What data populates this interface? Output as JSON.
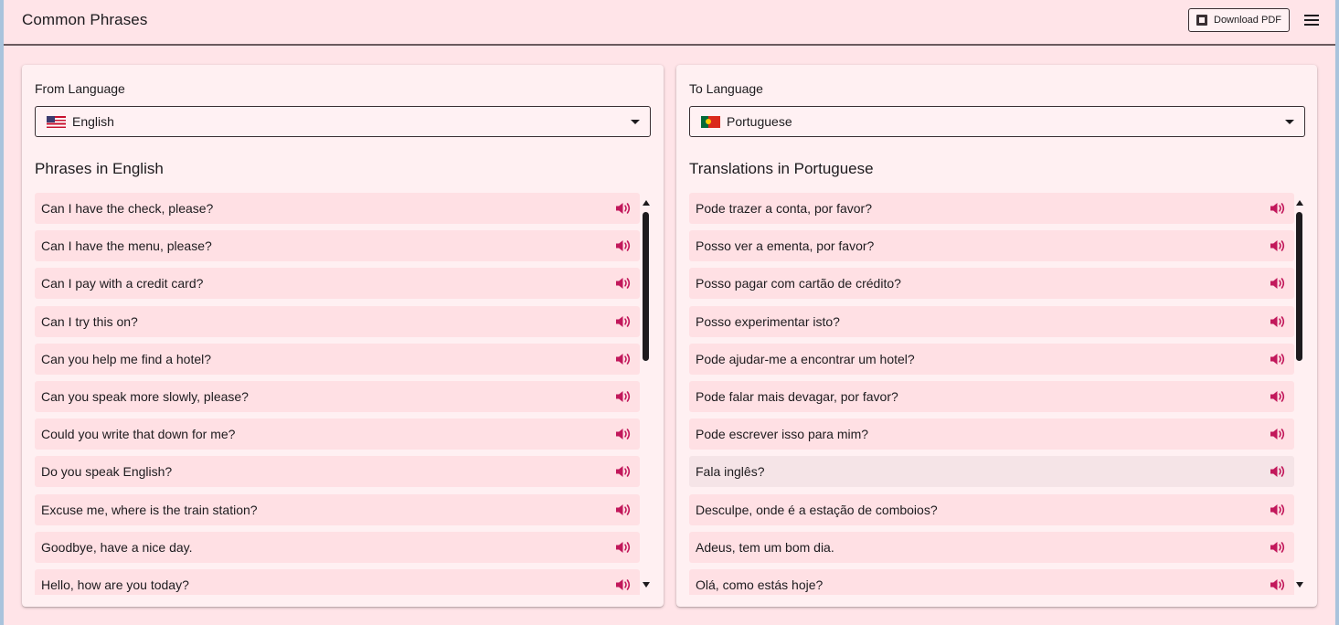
{
  "header": {
    "title": "Common Phrases",
    "download_label": "Download PDF",
    "icons": {
      "download": "pdf-icon",
      "menu": "menu-icon"
    }
  },
  "from": {
    "label": "From Language",
    "selected": "English",
    "flag": "us-flag",
    "section_title": "Phrases in English",
    "phrases": [
      "Can I have the check, please?",
      "Can I have the menu, please?",
      "Can I pay with a credit card?",
      "Can I try this on?",
      "Can you help me find a hotel?",
      "Can you speak more slowly, please?",
      "Could you write that down for me?",
      "Do you speak English?",
      "Excuse me, where is the train station?",
      "Goodbye, have a nice day.",
      "Hello, how are you today?"
    ]
  },
  "to": {
    "label": "To Language",
    "selected": "Portuguese",
    "flag": "portugal-flag",
    "section_title": "Translations in Portuguese",
    "phrases": [
      "Pode trazer a conta, por favor?",
      "Posso ver a ementa, por favor?",
      "Posso pagar com cartão de crédito?",
      "Posso experimentar isto?",
      "Pode ajudar-me a encontrar um hotel?",
      "Pode falar mais devagar, por favor?",
      "Pode escrever isso para mim?",
      "Fala inglês?",
      "Desculpe, onde é a estação de comboios?",
      "Adeus, tem um bom dia.",
      "Olá, como estás hoje?"
    ]
  },
  "colors": {
    "background": "#ffe4e8",
    "card": "#fff0f2",
    "item": "#ffe0e4",
    "accent": "#c2185b"
  },
  "icons": {
    "play": "speaker-icon"
  }
}
